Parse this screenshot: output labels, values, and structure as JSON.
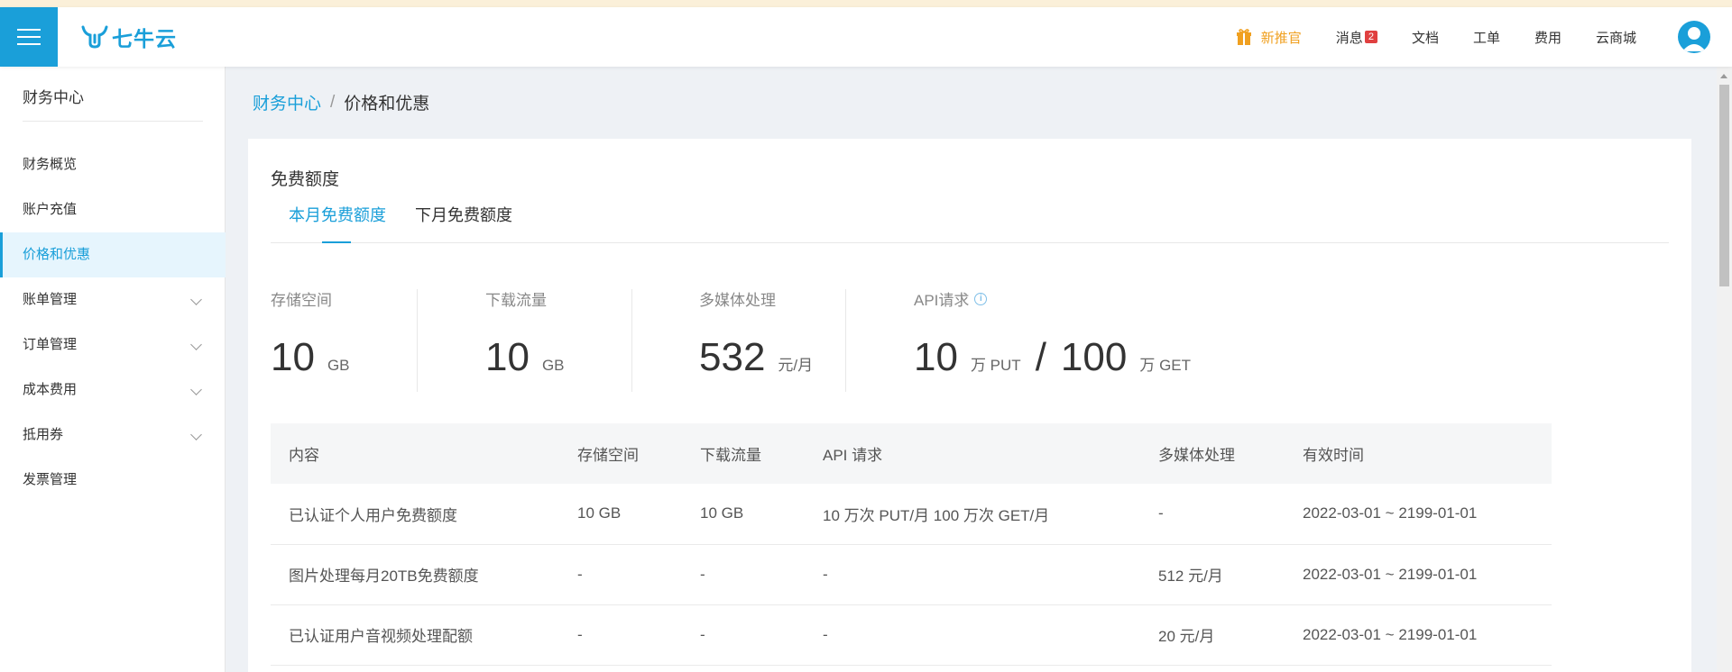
{
  "header": {
    "logo_text": "七牛云",
    "nav": [
      {
        "label": "新推官",
        "icon": "gift-icon"
      },
      {
        "label": "消息",
        "badge": "2"
      },
      {
        "label": "文档"
      },
      {
        "label": "工单"
      },
      {
        "label": "费用"
      },
      {
        "label": "云商城"
      }
    ],
    "accent_color": "#1a9fd9",
    "promo_color": "#f0a020"
  },
  "sidebar": {
    "title": "财务中心",
    "items": [
      {
        "label": "财务概览"
      },
      {
        "label": "账户充值"
      },
      {
        "label": "价格和优惠",
        "active": true
      },
      {
        "label": "账单管理",
        "expandable": true
      },
      {
        "label": "订单管理",
        "expandable": true
      },
      {
        "label": "成本费用",
        "expandable": true
      },
      {
        "label": "抵用券",
        "expandable": true
      },
      {
        "label": "发票管理"
      }
    ]
  },
  "breadcrumb": {
    "parent": "财务中心",
    "separator": "/",
    "current": "价格和优惠"
  },
  "free_quota": {
    "title": "免费额度",
    "tabs": [
      {
        "label": "本月免费额度",
        "active": true
      },
      {
        "label": "下月免费额度"
      }
    ],
    "stats": [
      {
        "label": "存储空间",
        "value": "10",
        "unit": "GB"
      },
      {
        "label": "下载流量",
        "value": "10",
        "unit": "GB"
      },
      {
        "label": "多媒体处理",
        "value": "532",
        "unit": "元/月"
      },
      {
        "label": "API请求",
        "value_put": "10",
        "unit_put": "万 PUT",
        "separator": "/",
        "value_get": "100",
        "unit_get": "万 GET",
        "info_icon": "i"
      }
    ],
    "table": {
      "headers": [
        "内容",
        "存储空间",
        "下载流量",
        "API 请求",
        "多媒体处理",
        "有效时间"
      ],
      "rows": [
        [
          "已认证个人用户免费额度",
          "10 GB",
          "10 GB",
          "10 万次 PUT/月 100 万次 GET/月",
          "-",
          "2022-03-01 ~ 2199-01-01"
        ],
        [
          "图片处理每月20TB免费额度",
          "-",
          "-",
          "-",
          "512 元/月",
          "2022-03-01 ~ 2199-01-01"
        ],
        [
          "已认证用户音视频处理配额",
          "-",
          "-",
          "-",
          "20 元/月",
          "2022-03-01 ~ 2199-01-01"
        ]
      ]
    }
  }
}
